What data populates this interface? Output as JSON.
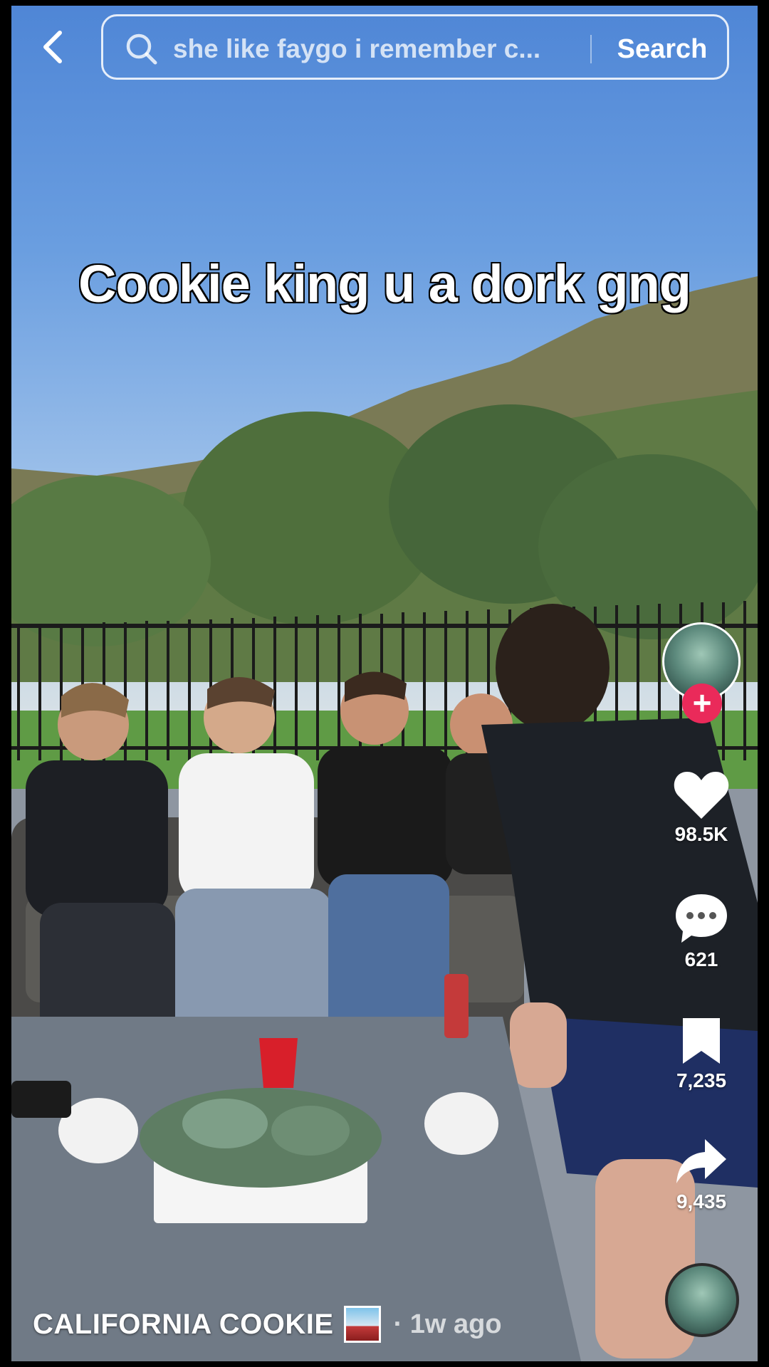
{
  "search": {
    "query": "she like faygo i remember c...",
    "button_label": "Search"
  },
  "video": {
    "caption": "Cookie king u a dork gng"
  },
  "actions": {
    "likes": "98.5K",
    "comments": "621",
    "saves": "7,235",
    "shares": "9,435",
    "follow_symbol": "+"
  },
  "author": {
    "name": "CALIFORNIA COOKIE",
    "time": "· 1w ago"
  },
  "colors": {
    "follow_accent": "#ea2a5a",
    "text": "#ffffff"
  },
  "icons": {
    "back": "chevron-left-icon",
    "search": "search-icon",
    "like": "heart-icon",
    "comment": "comment-bubble-icon",
    "save": "bookmark-icon",
    "share": "share-arrow-icon",
    "follow": "plus-icon"
  }
}
